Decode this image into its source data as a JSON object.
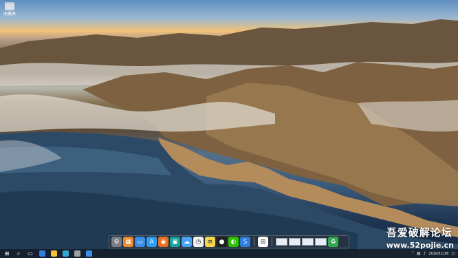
{
  "desktop": {
    "icons": [
      {
        "label": "收藏夹",
        "icon": "folder-icon"
      }
    ]
  },
  "dock": {
    "apps": [
      {
        "name": "settings",
        "icon": "gear-icon",
        "color": "#7a7f86",
        "glyph": "⚙"
      },
      {
        "name": "launchpad",
        "icon": "grid-icon",
        "color": "#f08a2c",
        "glyph": "▦"
      },
      {
        "name": "desktop",
        "icon": "monitor-icon",
        "color": "#3a8ee6",
        "glyph": "▭"
      },
      {
        "name": "app-store",
        "icon": "app-store-icon",
        "color": "#2f9df4",
        "glyph": "A"
      },
      {
        "name": "firefox",
        "icon": "firefox-icon",
        "color": "#e76f24",
        "glyph": "◉"
      },
      {
        "name": "wechat-work",
        "icon": "chat-icon",
        "color": "#16a39a",
        "glyph": "▣"
      },
      {
        "name": "weather",
        "icon": "cloud-icon",
        "color": "#4aa3f0",
        "glyph": "☁"
      },
      {
        "name": "clock",
        "icon": "clock-icon",
        "color": "#f2f2f2",
        "glyph": "◷"
      },
      {
        "name": "notes",
        "icon": "notes-icon",
        "color": "#f5d54a",
        "glyph": "≡"
      },
      {
        "name": "qq",
        "icon": "penguin-icon",
        "color": "#1f1f1f",
        "glyph": "●"
      },
      {
        "name": "wechat",
        "icon": "wechat-icon",
        "color": "#2dc100",
        "glyph": "◐"
      },
      {
        "name": "s-app",
        "icon": "s-icon",
        "color": "#2f7de1",
        "glyph": "S"
      }
    ],
    "after_sep": [
      {
        "name": "windows",
        "icon": "windows-logo-icon",
        "color": "#ffffff",
        "glyph": "⊞"
      }
    ],
    "thumbs": [
      {
        "name": "window-thumb-1"
      },
      {
        "name": "window-thumb-2"
      },
      {
        "name": "window-thumb-3"
      },
      {
        "name": "window-thumb-4"
      }
    ],
    "trash": {
      "name": "recycle-bin",
      "icon": "recycle-icon",
      "color": "#2fa84f",
      "glyph": "♻"
    }
  },
  "taskbar": {
    "start_icon": "windows-start-icon",
    "start_glyph": "⊞",
    "items": [
      {
        "name": "search",
        "icon": "search-icon",
        "glyph": "⌕"
      },
      {
        "name": "task-view",
        "icon": "task-view-icon",
        "glyph": "▭"
      },
      {
        "name": "app-1",
        "icon": "blue-app-icon",
        "color": "#2f7de1"
      },
      {
        "name": "app-2",
        "icon": "folder-icon",
        "color": "#f3c03c"
      },
      {
        "name": "app-3",
        "icon": "edge-icon",
        "color": "#2fa8d8"
      },
      {
        "name": "app-4",
        "icon": "finder-icon",
        "color": "#9aa0a8"
      },
      {
        "name": "app-5",
        "icon": "window-icon",
        "color": "#3a8ee6"
      }
    ],
    "tray": {
      "clock_time": "",
      "clock_date": "2020/11/26"
    }
  },
  "watermark": {
    "title": "吾爱破解论坛",
    "url": "www.52pojie.cn"
  }
}
